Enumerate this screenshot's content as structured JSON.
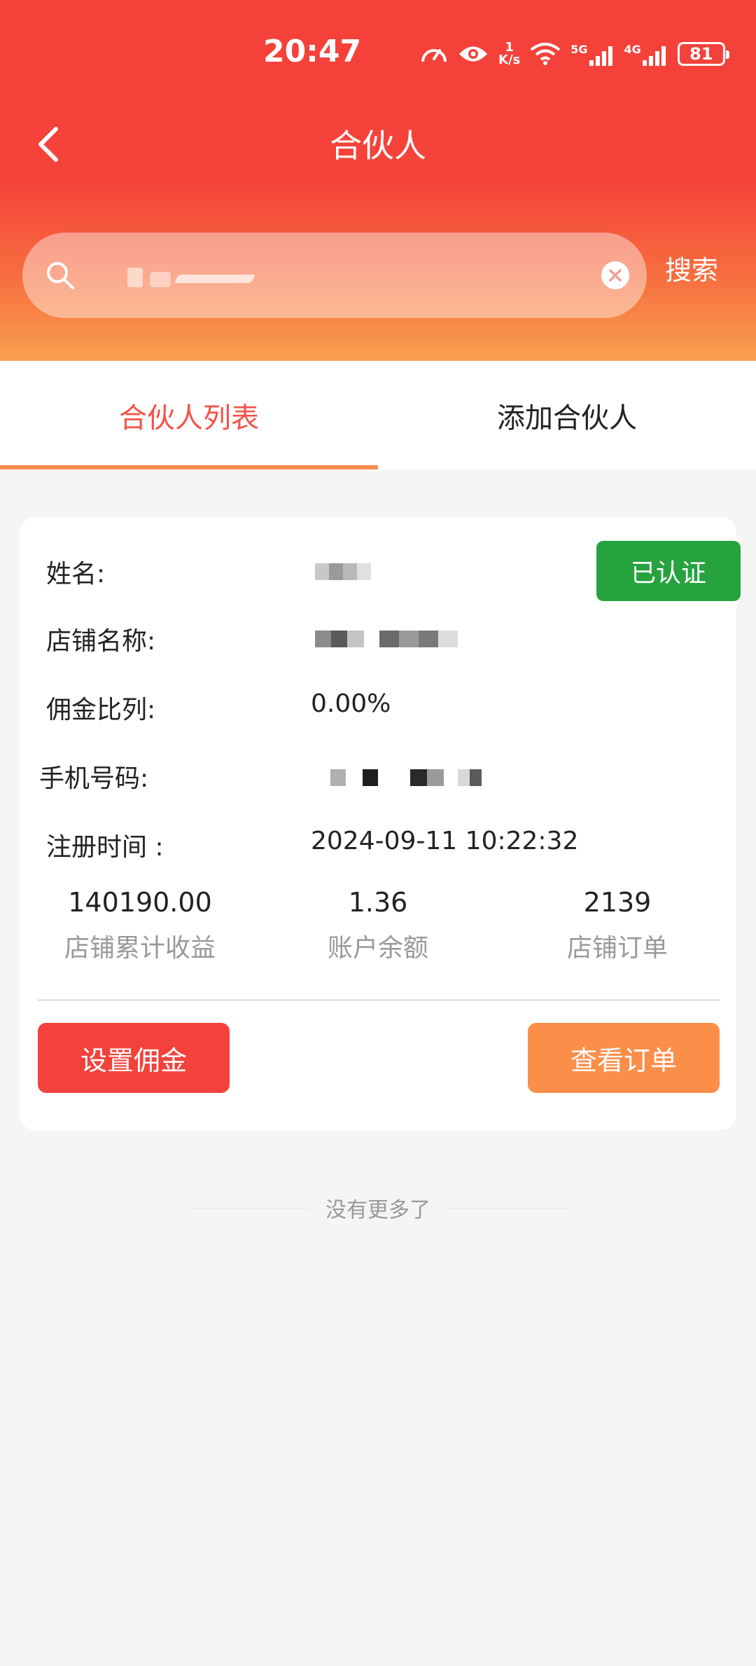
{
  "status_bar": {
    "time": "20:47",
    "net_speed_value": "1",
    "net_speed_unit": "K/s",
    "battery": "81",
    "network_labels": [
      "5G",
      "4G"
    ]
  },
  "nav": {
    "title": "合伙人"
  },
  "search": {
    "value": "",
    "button_label": "搜索"
  },
  "tabs": [
    {
      "label": "合伙人列表",
      "active": true
    },
    {
      "label": "添加合伙人",
      "active": false
    }
  ],
  "partner": {
    "name_label": "姓名:",
    "badge": "已认证",
    "store_name_label": "店铺名称:",
    "commission_label": "佣金比列:",
    "commission_value": "0.00%",
    "phone_label": "手机号码:",
    "register_label": "注册时间 :",
    "register_value": "2024-09-11 10:22:32",
    "stats": [
      {
        "value": "140190.00",
        "label": "店铺累计收益"
      },
      {
        "value": "1.36",
        "label": "账户余额"
      },
      {
        "value": "2139",
        "label": "店铺订单"
      }
    ],
    "set_commission_button": "设置佣金",
    "view_orders_button": "查看订单"
  },
  "footer": {
    "no_more": "没有更多了"
  },
  "colors": {
    "primary_red": "#f4413a",
    "orange": "#fb8e49",
    "verified_green": "#26a33f",
    "tab_active": "#f4534a"
  },
  "icons": [
    "back-icon",
    "search-icon",
    "clear-icon",
    "speedometer-icon",
    "eye-icon",
    "wifi-icon",
    "signal-icon",
    "battery-icon"
  ]
}
